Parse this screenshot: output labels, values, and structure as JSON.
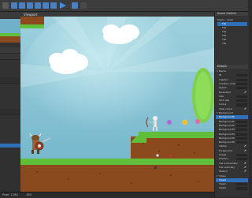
{
  "viewport": {
    "title": "Viewport"
  },
  "scene_outline": {
    "title": "Scene Outline",
    "scene_label": "Scene - Level",
    "items": [
      "Tile",
      "Tile",
      "Tile",
      "Tile",
      "Tile",
      "Tile"
    ],
    "selected_index": 0
  },
  "details": {
    "title": "Details",
    "rows": [
      {
        "label": "Name",
        "kind": "group"
      },
      {
        "label": "ID",
        "kind": "field"
      },
      {
        "label": "Caption",
        "kind": "field"
      },
      {
        "label": "Creation code",
        "kind": "field"
      },
      {
        "label": "Speed",
        "kind": "field"
      },
      {
        "label": "Persistent",
        "kind": "check"
      },
      {
        "label": "Size",
        "kind": "field"
      },
      {
        "label": "Grid size",
        "kind": "field"
      },
      {
        "label": "Colour",
        "kind": "field"
      },
      {
        "label": "View colour",
        "kind": "check"
      },
      {
        "label": "Background",
        "kind": "group"
      },
      {
        "label": "Background0",
        "kind": "sel"
      },
      {
        "label": "Background1",
        "kind": "field"
      },
      {
        "label": "Background2",
        "kind": "field"
      },
      {
        "label": "Background3",
        "kind": "field"
      },
      {
        "label": "Background4",
        "kind": "field"
      },
      {
        "label": "Background5",
        "kind": "field"
      },
      {
        "label": "Background6",
        "kind": "field"
      },
      {
        "label": "Visible",
        "kind": "check"
      },
      {
        "label": "Foreground",
        "kind": "check"
      },
      {
        "label": "Image",
        "kind": "field"
      },
      {
        "label": "Position",
        "kind": "field"
      },
      {
        "label": "Tile horizontally",
        "kind": "check"
      },
      {
        "label": "Tile vertically",
        "kind": "check"
      },
      {
        "label": "Stretch",
        "kind": "check"
      },
      {
        "label": "Views",
        "kind": "group"
      },
      {
        "label": "View0",
        "kind": "sel"
      },
      {
        "label": "View1",
        "kind": "field"
      },
      {
        "label": "View2",
        "kind": "field"
      }
    ]
  },
  "status": {
    "left": "Pixel: 1280",
    "right": "160"
  },
  "colors": {
    "selection": "#2f6fb8",
    "sky": "#8cc7d6",
    "grass": "#5fbe3a",
    "dirt": "#8a4a1e"
  }
}
